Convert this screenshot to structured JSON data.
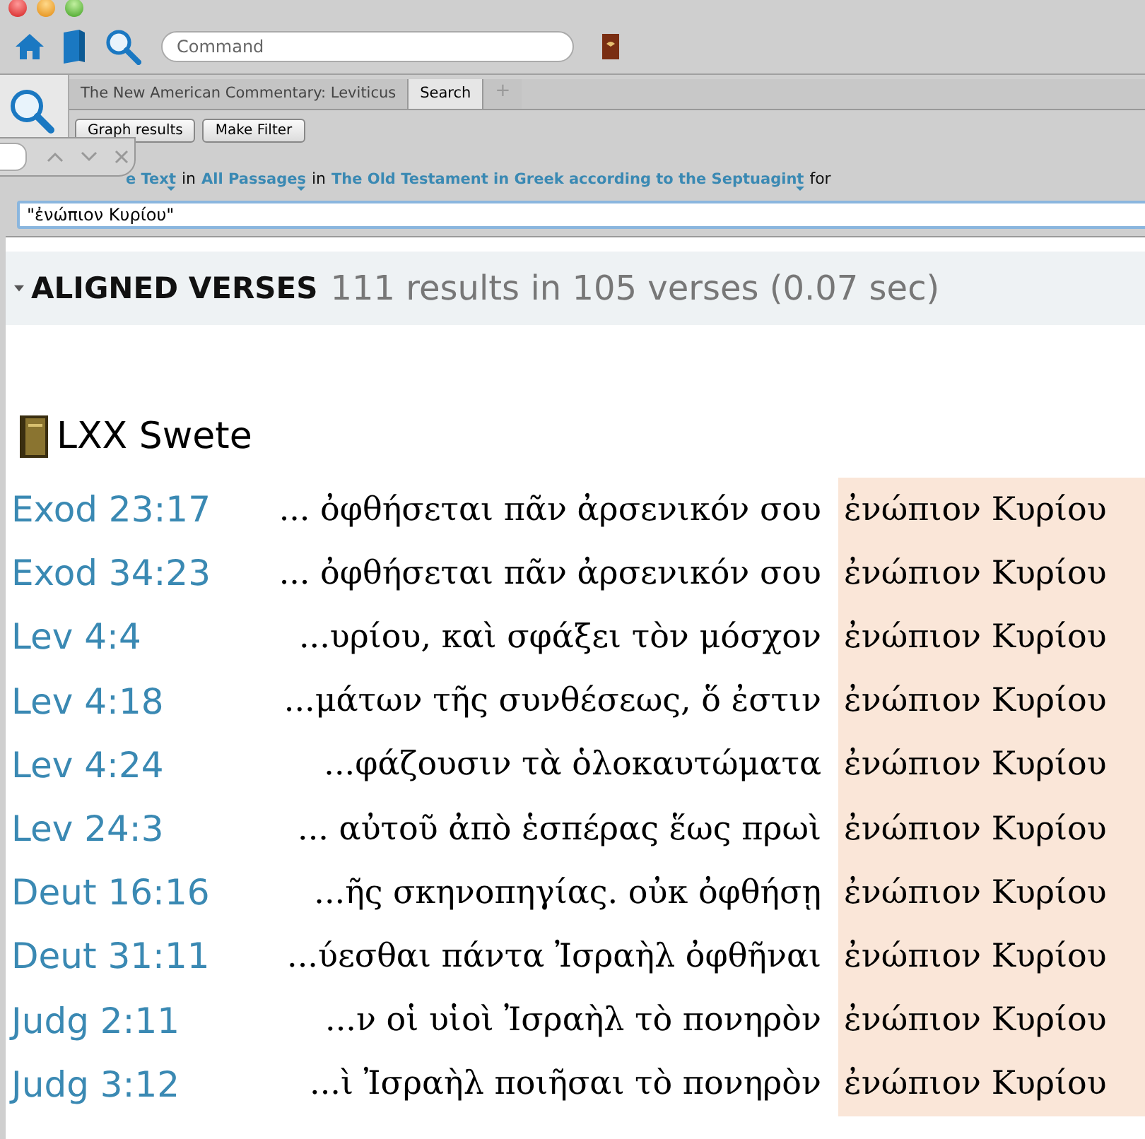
{
  "toolbar": {
    "command": {
      "placeholder": "Command"
    }
  },
  "tabs": [
    {
      "label": "The New American Commentary: Leviticus",
      "selected": false
    },
    {
      "label": "Search",
      "selected": true
    },
    {
      "label": "+",
      "selected": false
    }
  ],
  "buttons": [
    "Graph results",
    "Make Filter"
  ],
  "search_scope": [
    {
      "kind": "link",
      "text": "e Text"
    },
    {
      "kind": "text",
      "text": "in"
    },
    {
      "kind": "link",
      "text": "All Passages"
    },
    {
      "kind": "text",
      "text": "in"
    },
    {
      "kind": "link",
      "text": "The Old Testament in Greek according to the Septuagint"
    },
    {
      "kind": "text",
      "text": "for"
    }
  ],
  "query": "\"ἐνώπιον Κυρίου\"",
  "results_header": {
    "title": "ALIGNED VERSES",
    "summary": "111 results in 105 verses (0.07 sec)",
    "expanded": true
  },
  "resource": "LXX Swete",
  "rows": [
    {
      "ref": "Exod 23:17",
      "context": "... ὀφθήσεται πᾶν ἀρσενικόν σου",
      "match": "ἐνώπιον Κυρίου"
    },
    {
      "ref": "Exod 34:23",
      "context": "... ὀφθήσεται πᾶν ἀρσενικόν σου",
      "match": "ἐνώπιον Κυρίου"
    },
    {
      "ref": "Lev 4:4",
      "context": "...υρίου, καὶ σφάξει τὸν μόσχον",
      "match": "ἐνώπιον Κυρίου"
    },
    {
      "ref": "Lev 4:18",
      "context": "...μάτων τῆς συνθέσεως, ὅ ἐστιν",
      "match": "ἐνώπιον Κυρίου"
    },
    {
      "ref": "Lev 4:24",
      "context": "...φάζουσιν τὰ ὁλοκαυτώματα",
      "match": "ἐνώπιον Κυρίου"
    },
    {
      "ref": "Lev 24:3",
      "context": "... αὐτοῦ ἀπὸ ἑσπέρας ἕως πρωὶ",
      "match": "ἐνώπιον Κυρίου"
    },
    {
      "ref": "Deut 16:16",
      "context": "...ῆς σκηνοπηγίας. οὐκ ὀφθήσῃ",
      "match": "ἐνώπιον Κυρίου"
    },
    {
      "ref": "Deut 31:11",
      "context": "...ύεσθαι πάντα Ἰσραὴλ ὀφθῆναι",
      "match": "ἐνώπιον Κυρίου"
    },
    {
      "ref": "Judg 2:11",
      "context": "...ν οἱ υἱοὶ Ἰσραὴλ τὸ πονηρὸν",
      "match": "ἐνώπιον Κυρίου"
    },
    {
      "ref": "Judg 3:12",
      "context": "...ὶ Ἰσραὴλ ποιῆσαι τὸ πονηρὸν",
      "match": "ἐνώπιον Κυρίου"
    }
  ]
}
